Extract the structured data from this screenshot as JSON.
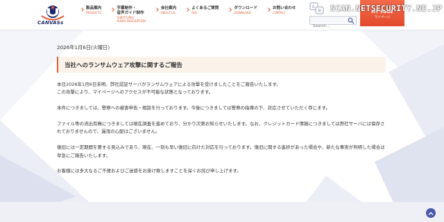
{
  "header": {
    "logo_text": "CANVASs",
    "nav": [
      {
        "jp": "製品案内",
        "en": "PRODUCTS"
      },
      {
        "jp": "字幕制作・\n音声ガイド制作",
        "en": "SUBTITLING/\nAUDIO DESCRIPTION"
      },
      {
        "jp": "会社案内",
        "en": "ABOUT US"
      },
      {
        "jp": "よくあるご質問",
        "en": "FAQ"
      },
      {
        "jp": "ダウンロード",
        "en": "DOWNLOAD"
      },
      {
        "jp": "お問い合わせ",
        "en": "CONTACT"
      }
    ],
    "search_placeholder": "Search...",
    "mypage_jp": "MY PAGE",
    "mypage_en": "マイページ",
    "watermark": "SCAN.NETSECURITY.NE.JP"
  },
  "article": {
    "date": "2026年1月6日(火曜日)",
    "title": "当社へのランサムウェア攻撃に関するご報告",
    "paragraphs": [
      "本日2026年1月6日未明、弊社認証サーバがランサムウェアによる攻撃を受けましたことをご報告いたします。\nこの攻撃により、マイページへのアクセスが不可能な状態となっております。",
      "本件につきましては、警察への被害申告・相談を行っております。今後につきましては警察の指導の下、対応させていただく存じます。",
      "ファイル等の流出有無につきましては現在調査を進めており、分かり次第お知らせいたします。なお、クレジットカード情報につきましては弊社サーバには保存されておりませんので、漏洩の心配はございません。",
      "復旧には一定期間を要する見込みであり、現在、一刻も早い復旧に向けた対応を行っております。復旧に関する進捗があった場合や、新たな事実が判明した場合は早急にご報告いたします。",
      "お客様には多大なるご不便およびご迷惑をお掛け致しますことを深くお詫び申し上げます。"
    ]
  },
  "colors": {
    "accent": "#e05a33",
    "brand_navy": "#1a2a6c",
    "title_bg": "#fbf2ea"
  },
  "icons": {
    "logo": "canvass-logo",
    "language": "language-icon",
    "search": "search-icon",
    "to_top": "chevron-up-icon"
  }
}
